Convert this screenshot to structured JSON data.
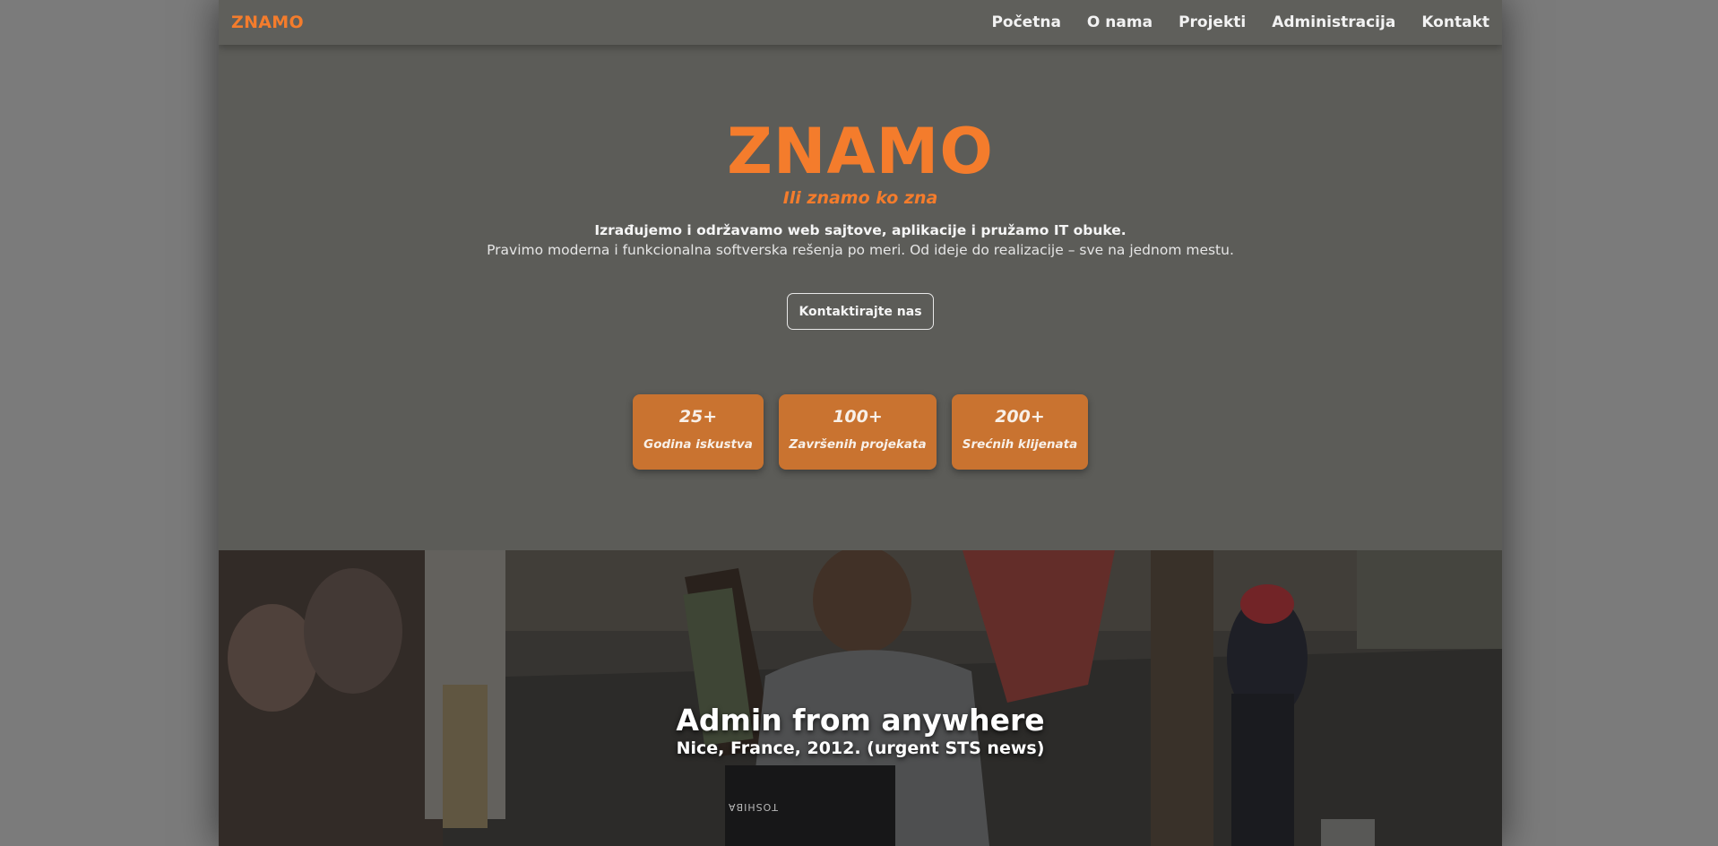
{
  "nav": {
    "brand": "ZNAMO",
    "links": [
      "Početna",
      "O nama",
      "Projekti",
      "Administracija",
      "Kontakt"
    ]
  },
  "hero": {
    "title": "ZNAMO",
    "tagline": "Ili znamo ko zna",
    "line1": "Izrađujemo i održavamo web sajtove, aplikacije i pružamo IT obuke.",
    "line2": "Pravimo moderna i funkcionalna softverska rešenja po meri. Od ideje do realizacije – sve na jednom mestu.",
    "cta_label": "Kontaktirajte nas"
  },
  "stats": [
    {
      "value": "25+",
      "label": "Godina iskustva"
    },
    {
      "value": "100+",
      "label": "Završenih projekata"
    },
    {
      "value": "200+",
      "label": "Srećnih klijenata"
    }
  ],
  "banner": {
    "title": "Admin from anywhere",
    "caption": "Nice, France, 2012. (urgent STS news)",
    "laptop_brand": "TOSHIBA"
  },
  "colors": {
    "accent": "#f47c2c",
    "stat_bg": "#c97330",
    "page_bg": "#5c5c58",
    "outer_bg": "#7b7b7b"
  }
}
